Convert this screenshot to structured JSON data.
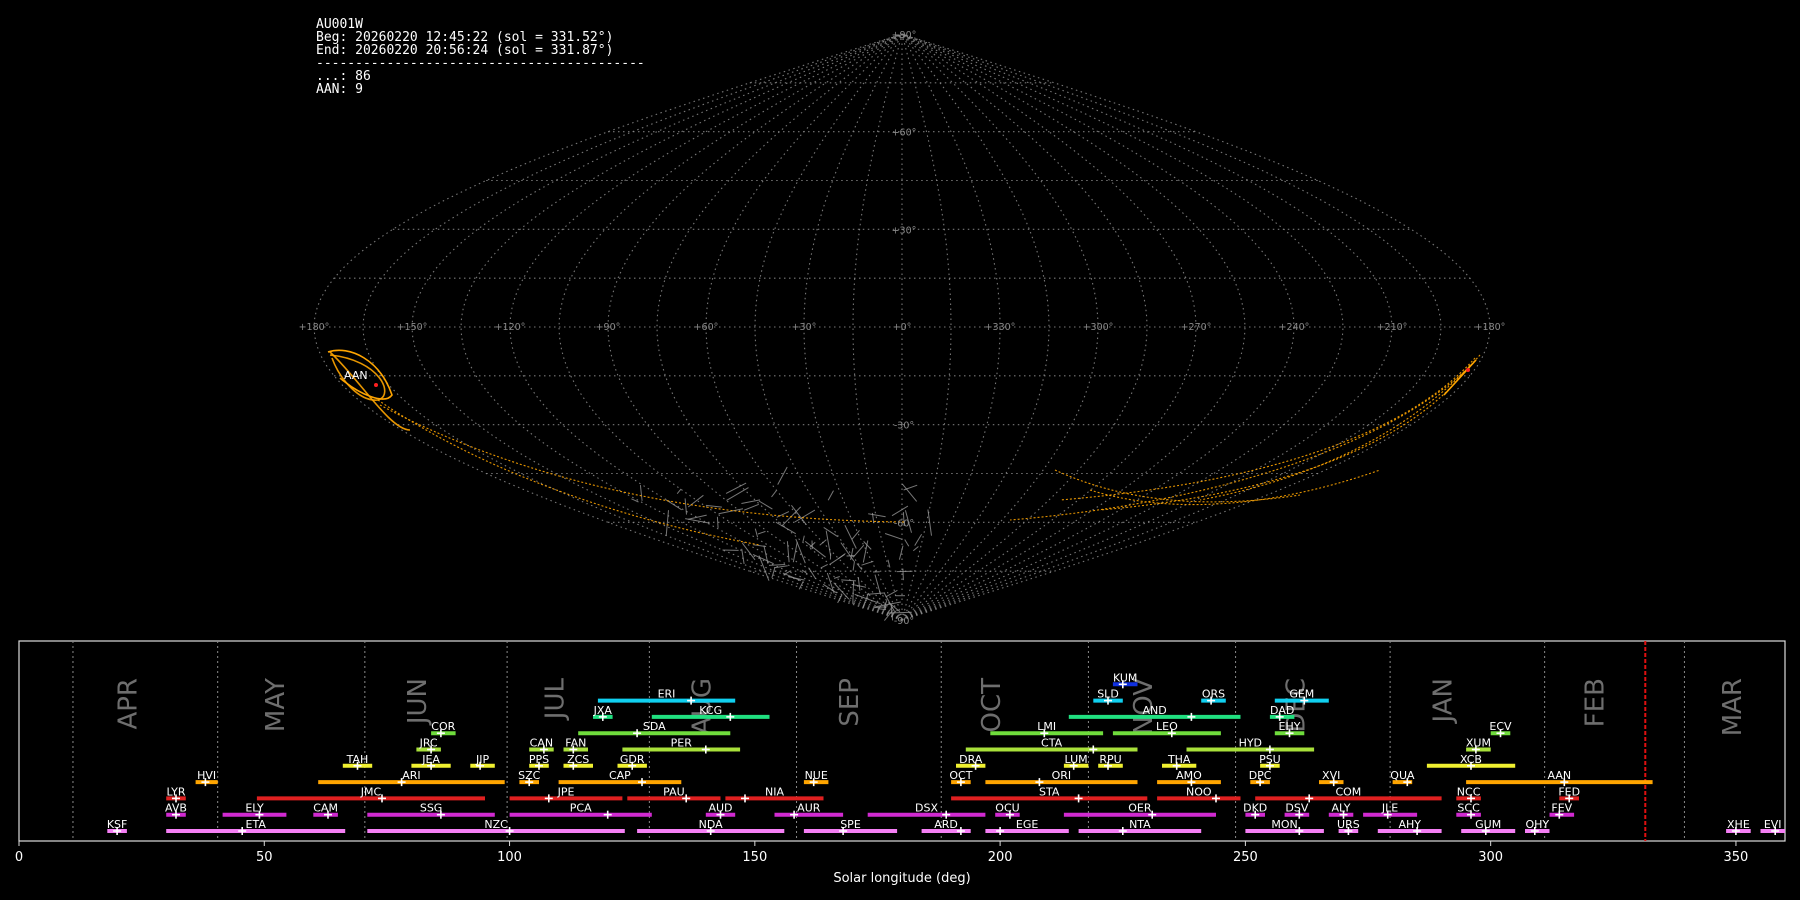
{
  "info": {
    "station": "AU001W",
    "beg": "Beg: 20260220 12:45:22 (sol = 331.52°)",
    "end": "End: 20260220 20:56:24 (sol = 331.87°)",
    "separator": "------------------------------------------",
    "sporadic": "...: 86",
    "aan": "AAN: 9"
  },
  "sky_map": {
    "projection": "sinusoidal",
    "lon_labels": [
      "+180°",
      "+150°",
      "+120°",
      "+90°",
      "+60°",
      "+30°",
      "+0°",
      "+330°",
      "+300°",
      "+270°",
      "+240°",
      "+210°",
      "+180°"
    ],
    "lat_labels": [
      "+90°",
      "+60°",
      "+30°",
      "-30°",
      "-60°",
      "-90°"
    ],
    "shower_label": "AAN",
    "colors": {
      "grid": "#8c8c8c",
      "sporadic": "#a0a0a0",
      "shower": "#ffa500",
      "radiant": "#ff2020"
    }
  },
  "chart_data": {
    "type": "timeline",
    "xlabel": "Solar longitude (deg)",
    "xlim": [
      0,
      360
    ],
    "xticks": [
      "0",
      "50",
      "100",
      "150",
      "200",
      "250",
      "300",
      "350"
    ],
    "current_sol": 331.52,
    "month_labels": [
      {
        "name": "APR",
        "sol": 24
      },
      {
        "name": "MAY",
        "sol": 54
      },
      {
        "name": "JUN",
        "sol": 83
      },
      {
        "name": "JUL",
        "sol": 111
      },
      {
        "name": "AUG",
        "sol": 141
      },
      {
        "name": "SEP",
        "sol": 171
      },
      {
        "name": "OCT",
        "sol": 200
      },
      {
        "name": "NOV",
        "sol": 231
      },
      {
        "name": "DEC",
        "sol": 262
      },
      {
        "name": "JAN",
        "sol": 292
      },
      {
        "name": "FEB",
        "sol": 323
      },
      {
        "name": "MAR",
        "sol": 351
      }
    ],
    "month_bounds": [
      11,
      40.5,
      70.5,
      99.5,
      128.5,
      158.5,
      188,
      218,
      248,
      279.5,
      311,
      339.5
    ],
    "showers": [
      {
        "code": "KSF",
        "start": 18,
        "end": 22,
        "peak": 20,
        "row": 0,
        "color": "#f47ff4"
      },
      {
        "code": "ETA",
        "start": 30,
        "end": 66.5,
        "peak": 45.5,
        "row": 0,
        "color": "#f47ff4"
      },
      {
        "code": "NZC",
        "start": 71,
        "end": 123.5,
        "peak": 100,
        "row": 0,
        "color": "#f47ff4"
      },
      {
        "code": "NDA",
        "start": 126,
        "end": 156,
        "peak": 141,
        "row": 0,
        "color": "#f47ff4"
      },
      {
        "code": "SPE",
        "start": 160,
        "end": 179,
        "peak": 168,
        "row": 0,
        "color": "#f47ff4"
      },
      {
        "code": "ARD",
        "start": 184,
        "end": 194,
        "peak": 192,
        "row": 0,
        "color": "#f47ff4"
      },
      {
        "code": "EGE",
        "start": 197,
        "end": 214,
        "peak": 200,
        "row": 0,
        "color": "#f47ff4"
      },
      {
        "code": "NTA",
        "start": 216,
        "end": 241,
        "peak": 225,
        "row": 0,
        "color": "#f47ff4"
      },
      {
        "code": "MON",
        "start": 250,
        "end": 266,
        "peak": 261,
        "row": 0,
        "color": "#f47ff4"
      },
      {
        "code": "URS",
        "start": 269,
        "end": 273,
        "peak": 271,
        "row": 0,
        "color": "#f47ff4"
      },
      {
        "code": "AHY",
        "start": 277,
        "end": 290,
        "peak": 285,
        "row": 0,
        "color": "#f47ff4"
      },
      {
        "code": "GUM",
        "start": 294,
        "end": 305,
        "peak": 299,
        "row": 0,
        "color": "#f47ff4"
      },
      {
        "code": "OHY",
        "start": 307,
        "end": 312,
        "peak": 309,
        "row": 0,
        "color": "#f47ff4"
      },
      {
        "code": "XHE",
        "start": 348,
        "end": 353,
        "peak": 350,
        "row": 0,
        "color": "#f47ff4"
      },
      {
        "code": "EVI",
        "start": 355,
        "end": 360,
        "peak": 358,
        "row": 0,
        "color": "#f47ff4"
      },
      {
        "code": "AVB",
        "start": 30,
        "end": 34,
        "peak": 32,
        "row": 1,
        "color": "#d12ad1"
      },
      {
        "code": "ELY",
        "start": 41.5,
        "end": 54.5,
        "peak": 49,
        "row": 1,
        "color": "#d12ad1"
      },
      {
        "code": "CAM",
        "start": 60,
        "end": 65,
        "peak": 63,
        "row": 1,
        "color": "#d12ad1"
      },
      {
        "code": "SSG",
        "start": 71,
        "end": 97,
        "peak": 86,
        "row": 1,
        "color": "#d12ad1"
      },
      {
        "code": "PCA",
        "start": 100,
        "end": 129,
        "peak": 120,
        "row": 1,
        "color": "#d12ad1"
      },
      {
        "code": "AUD",
        "start": 140,
        "end": 146,
        "peak": 143,
        "row": 1,
        "color": "#d12ad1"
      },
      {
        "code": "AUR",
        "start": 154,
        "end": 168,
        "peak": 158,
        "row": 1,
        "color": "#d12ad1"
      },
      {
        "code": "DSX",
        "start": 173,
        "end": 197,
        "peak": 189,
        "row": 1,
        "color": "#d12ad1"
      },
      {
        "code": "OCU",
        "start": 199,
        "end": 204,
        "peak": 202,
        "row": 1,
        "color": "#d12ad1"
      },
      {
        "code": "OER",
        "start": 213,
        "end": 244,
        "peak": 231,
        "row": 1,
        "color": "#d12ad1"
      },
      {
        "code": "DKD",
        "start": 250,
        "end": 254,
        "peak": 252,
        "row": 1,
        "color": "#d12ad1"
      },
      {
        "code": "DSV",
        "start": 258,
        "end": 263,
        "peak": 261,
        "row": 1,
        "color": "#d12ad1"
      },
      {
        "code": "ALY",
        "start": 267,
        "end": 272,
        "peak": 270,
        "row": 1,
        "color": "#d12ad1"
      },
      {
        "code": "JLE",
        "start": 274,
        "end": 285,
        "peak": 279,
        "row": 1,
        "color": "#d12ad1"
      },
      {
        "code": "SCC",
        "start": 293,
        "end": 298,
        "peak": 296,
        "row": 1,
        "color": "#d12ad1"
      },
      {
        "code": "FEV",
        "start": 312,
        "end": 317,
        "peak": 314,
        "row": 1,
        "color": "#d12ad1"
      },
      {
        "code": "LYR",
        "start": 30,
        "end": 34,
        "peak": 32,
        "row": 2,
        "color": "#e02020"
      },
      {
        "code": "JMC",
        "start": 48.5,
        "end": 95,
        "peak": 74,
        "row": 2,
        "color": "#e02020"
      },
      {
        "code": "JPE",
        "start": 100,
        "end": 123,
        "peak": 108,
        "row": 2,
        "color": "#e02020"
      },
      {
        "code": "PAU",
        "start": 124,
        "end": 143,
        "peak": 136,
        "row": 2,
        "color": "#e02020"
      },
      {
        "code": "NIA",
        "start": 144,
        "end": 164,
        "peak": 148,
        "row": 2,
        "color": "#e02020"
      },
      {
        "code": "STA",
        "start": 190,
        "end": 230,
        "peak": 216,
        "row": 2,
        "color": "#e02020"
      },
      {
        "code": "NOO",
        "start": 232,
        "end": 249,
        "peak": 244,
        "row": 2,
        "color": "#e02020"
      },
      {
        "code": "COM",
        "start": 252,
        "end": 290,
        "peak": 263,
        "row": 2,
        "color": "#e02020"
      },
      {
        "code": "NCC",
        "start": 293,
        "end": 298,
        "peak": 296,
        "row": 2,
        "color": "#e02020"
      },
      {
        "code": "FED",
        "start": 314,
        "end": 318,
        "peak": 316,
        "row": 2,
        "color": "#e02020"
      },
      {
        "code": "HVI",
        "start": 36,
        "end": 40.5,
        "peak": 38,
        "row": 3,
        "color": "#ffa500"
      },
      {
        "code": "ARI",
        "start": 61,
        "end": 99,
        "peak": 78,
        "row": 3,
        "color": "#ffa500"
      },
      {
        "code": "SZC",
        "start": 102,
        "end": 106,
        "peak": 104,
        "row": 3,
        "color": "#ffa500"
      },
      {
        "code": "CAP",
        "start": 110,
        "end": 135,
        "peak": 127,
        "row": 3,
        "color": "#ffa500"
      },
      {
        "code": "NUE",
        "start": 160,
        "end": 165,
        "peak": 162,
        "row": 3,
        "color": "#ffa500"
      },
      {
        "code": "OCT",
        "start": 190,
        "end": 194,
        "peak": 192,
        "row": 3,
        "color": "#ffa500"
      },
      {
        "code": "ORI",
        "start": 197,
        "end": 228,
        "peak": 208,
        "row": 3,
        "color": "#ffa500"
      },
      {
        "code": "AMO",
        "start": 232,
        "end": 245,
        "peak": 239,
        "row": 3,
        "color": "#ffa500"
      },
      {
        "code": "DPC",
        "start": 251,
        "end": 255,
        "peak": 253,
        "row": 3,
        "color": "#ffa500"
      },
      {
        "code": "XVI",
        "start": 265,
        "end": 270,
        "peak": 268,
        "row": 3,
        "color": "#ffa500"
      },
      {
        "code": "QUA",
        "start": 280,
        "end": 284,
        "peak": 283,
        "row": 3,
        "color": "#ffa500"
      },
      {
        "code": "AAN",
        "start": 295,
        "end": 333,
        "peak": 315,
        "row": 3,
        "color": "#ffa500"
      },
      {
        "code": "TAH",
        "start": 66,
        "end": 72,
        "peak": 69,
        "row": 4,
        "color": "#f0f030"
      },
      {
        "code": "JEA",
        "start": 80,
        "end": 88,
        "peak": 84,
        "row": 4,
        "color": "#f0f030"
      },
      {
        "code": "JIP",
        "start": 92,
        "end": 97,
        "peak": 94,
        "row": 4,
        "color": "#f0f030"
      },
      {
        "code": "PPS",
        "start": 104,
        "end": 108,
        "peak": 106,
        "row": 4,
        "color": "#f0f030"
      },
      {
        "code": "ZCS",
        "start": 111,
        "end": 117,
        "peak": 113,
        "row": 4,
        "color": "#f0f030"
      },
      {
        "code": "GDR",
        "start": 122,
        "end": 128,
        "peak": 125,
        "row": 4,
        "color": "#f0f030"
      },
      {
        "code": "DRA",
        "start": 191,
        "end": 197,
        "peak": 195,
        "row": 4,
        "color": "#f0f030"
      },
      {
        "code": "LUM",
        "start": 213,
        "end": 218,
        "peak": 215,
        "row": 4,
        "color": "#f0f030"
      },
      {
        "code": "RPU",
        "start": 220,
        "end": 225,
        "peak": 222,
        "row": 4,
        "color": "#f0f030"
      },
      {
        "code": "THA",
        "start": 233,
        "end": 240,
        "peak": 236,
        "row": 4,
        "color": "#f0f030"
      },
      {
        "code": "PSU",
        "start": 253,
        "end": 257,
        "peak": 255,
        "row": 4,
        "color": "#f0f030"
      },
      {
        "code": "XCB",
        "start": 287,
        "end": 305,
        "peak": 296,
        "row": 4,
        "color": "#f0f030"
      },
      {
        "code": "JRC",
        "start": 81,
        "end": 86,
        "peak": 84,
        "row": 5,
        "color": "#a8e03a"
      },
      {
        "code": "CAN",
        "start": 104,
        "end": 109,
        "peak": 107,
        "row": 5,
        "color": "#a8e03a"
      },
      {
        "code": "FAN",
        "start": 111,
        "end": 116,
        "peak": 113,
        "row": 5,
        "color": "#a8e03a"
      },
      {
        "code": "PER",
        "start": 123,
        "end": 147,
        "peak": 140,
        "row": 5,
        "color": "#a8e03a"
      },
      {
        "code": "CTA",
        "start": 193,
        "end": 228,
        "peak": 219,
        "row": 5,
        "color": "#a8e03a"
      },
      {
        "code": "HYD",
        "start": 238,
        "end": 264,
        "peak": 255,
        "row": 5,
        "color": "#a8e03a"
      },
      {
        "code": "XUM",
        "start": 295,
        "end": 300,
        "peak": 297,
        "row": 5,
        "color": "#a8e03a"
      },
      {
        "code": "COR",
        "start": 84,
        "end": 89,
        "peak": 86,
        "row": 6,
        "color": "#6fdc3c"
      },
      {
        "code": "SDA",
        "start": 114,
        "end": 145,
        "peak": 126,
        "row": 6,
        "color": "#6fdc3c"
      },
      {
        "code": "LMI",
        "start": 198,
        "end": 221,
        "peak": 209,
        "row": 6,
        "color": "#6fdc3c"
      },
      {
        "code": "LEO",
        "start": 223,
        "end": 245,
        "peak": 235,
        "row": 6,
        "color": "#6fdc3c"
      },
      {
        "code": "EHY",
        "start": 256,
        "end": 262,
        "peak": 259,
        "row": 6,
        "color": "#6fdc3c"
      },
      {
        "code": "ECV",
        "start": 300,
        "end": 304,
        "peak": 302,
        "row": 6,
        "color": "#6fdc3c"
      },
      {
        "code": "JXA",
        "start": 117,
        "end": 121,
        "peak": 119,
        "row": 7,
        "color": "#20e080"
      },
      {
        "code": "KCG",
        "start": 129,
        "end": 153,
        "peak": 145,
        "row": 7,
        "color": "#20e080"
      },
      {
        "code": "AND",
        "start": 214,
        "end": 249,
        "peak": 239,
        "row": 7,
        "color": "#20e080"
      },
      {
        "code": "DAD",
        "start": 255,
        "end": 260,
        "peak": 257,
        "row": 7,
        "color": "#20e080"
      },
      {
        "code": "ERI",
        "start": 118,
        "end": 146,
        "peak": 137,
        "row": 8,
        "color": "#10d0f0"
      },
      {
        "code": "SLD",
        "start": 219,
        "end": 225,
        "peak": 222,
        "row": 8,
        "color": "#10d0f0"
      },
      {
        "code": "ORS",
        "start": 241,
        "end": 246,
        "peak": 243,
        "row": 8,
        "color": "#10d0f0"
      },
      {
        "code": "GEM",
        "start": 256,
        "end": 267,
        "peak": 262,
        "row": 8,
        "color": "#10d0f0"
      },
      {
        "code": "KUM",
        "start": 223,
        "end": 228,
        "peak": 225,
        "row": 9,
        "color": "#1030e0"
      }
    ]
  }
}
